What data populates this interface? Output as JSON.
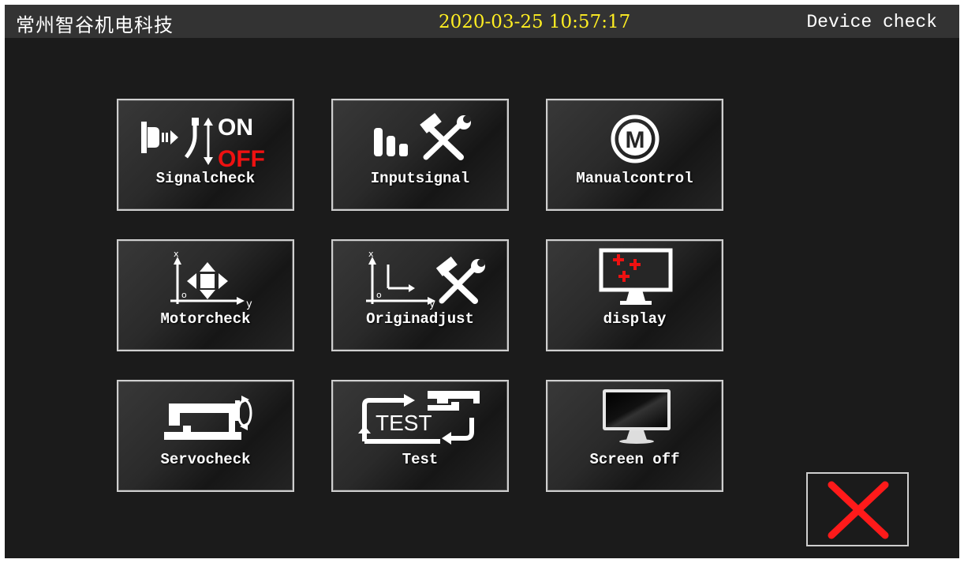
{
  "header": {
    "brand": "常州智谷机电科技",
    "datetime": "2020-03-25 10:57:17",
    "page_title": "Device check"
  },
  "tiles": [
    {
      "label": "Signalcheck",
      "icon": "signal-on-off-icon",
      "icon_text_on": "ON",
      "icon_text_off": "OFF"
    },
    {
      "label": "Inputsignal",
      "icon": "bars-tools-icon"
    },
    {
      "label": "Manualcontrol",
      "icon": "manual-m-icon",
      "icon_letter": "M"
    },
    {
      "label": "Motorcheck",
      "icon": "axis-move-icon",
      "axis_x": "x",
      "axis_y": "y",
      "axis_o": "o"
    },
    {
      "label": "Originadjust",
      "icon": "axis-tools-icon",
      "axis_x": "x",
      "axis_y": "y",
      "axis_o": "o"
    },
    {
      "label": "display",
      "icon": "monitor-crosses-icon"
    },
    {
      "label": "Servocheck",
      "icon": "sewing-machine-rotate-icon"
    },
    {
      "label": "Test",
      "icon": "test-cycle-icon",
      "icon_text": "TEST"
    },
    {
      "label": "Screen off",
      "icon": "monitor-off-icon"
    }
  ],
  "colors": {
    "background": "#1b1b1b",
    "header": "#333333",
    "datetime": "#ffee22",
    "accent_red": "#ee1111",
    "close_red": "#ff1a1a"
  },
  "exit": {
    "icon": "close-x-icon"
  }
}
